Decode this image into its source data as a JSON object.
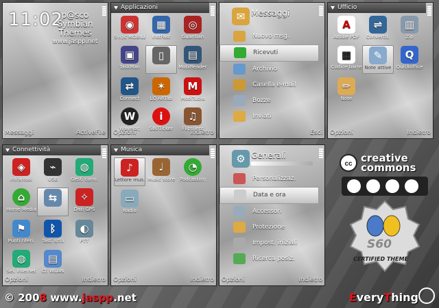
{
  "screen1": {
    "clock": "11:02",
    "brand_line1": "p@sco",
    "brand_line2": "Symbian Themes",
    "brand_line3": "www.jaspp.net",
    "soft_left": "Messaggi",
    "soft_right": "ActiveFile"
  },
  "screen2": {
    "title": "Applicazioni",
    "items": [
      "Sygic MOBILE",
      "InstFast",
      "Guardian",
      "TaskMan",
      "",
      "MobiReader",
      "Connect",
      "LQ ARTab",
      "MobiTubia",
      "Wavelog",
      "S60Ticker",
      "Flipsilent"
    ],
    "soft_left": "Opzioni",
    "soft_right": "Indietro"
  },
  "screen3": {
    "title": "Messaggi",
    "items": [
      "Nuovo msg.",
      "Ricevuti",
      "Archivio",
      "Casella e-mail",
      "Bozze",
      "Inviati"
    ],
    "soft_right": "Esci"
  },
  "screen4": {
    "title": "Ufficio",
    "items": [
      "Adobe PDF",
      "Convertit.",
      "Zip",
      "Codice barre",
      "Note attive",
      "Quickoffice",
      "Note"
    ],
    "soft_left": "Opzioni",
    "soft_right": "Indietro"
  },
  "screen5": {
    "title": "Connettività",
    "items": [
      "Infrarossi",
      "USB",
      "Gest. conn.",
      "Home Media",
      "",
      "Dati GPS",
      "Punti riferi.",
      "Tast. s/fili",
      "PTT",
      "Sel. Internet",
      "Cf. WLAN"
    ],
    "soft_left": "Opzioni",
    "soft_right": "Indietro"
  },
  "screen6": {
    "title": "Musica",
    "items": [
      "Lettore mus.",
      "Music store",
      "Podcasting",
      "Radio"
    ],
    "soft_left": "Opzioni",
    "soft_right": "Indietro"
  },
  "screen7": {
    "title": "Generali",
    "items": [
      "Personalizzaz.",
      "Data e ora",
      "Accessori",
      "Protezione",
      "Impost. iniziali",
      "Ricerca posiz."
    ],
    "soft_left": "Opzioni",
    "soft_right": "Indietro"
  },
  "badges": {
    "cc_line1": "creative",
    "cc_line2": "commons",
    "cert": "CERTIFIED THEME",
    "s60": "S60"
  },
  "footer": {
    "copyright_c": "©",
    "copyright_year_pre": "200",
    "copyright_year_8": "8",
    "copyright_url_pre": "www.",
    "copyright_url_red": "jaspp",
    "copyright_url_post": ".net",
    "every_E": "E",
    "every_rest": "very",
    "every_T": "T",
    "every_hing": "hing"
  }
}
